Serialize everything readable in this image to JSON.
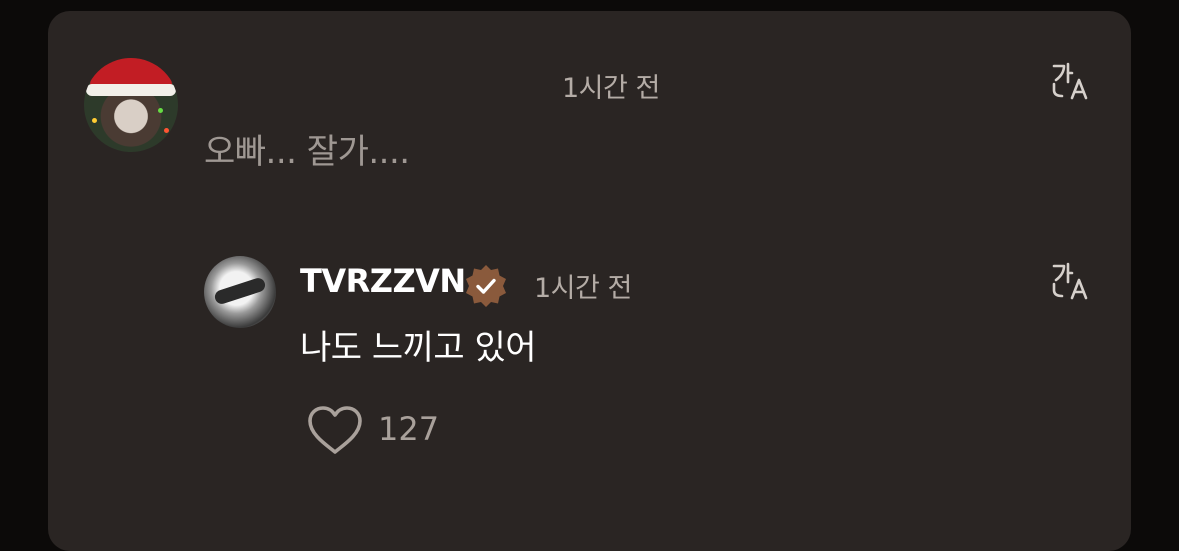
{
  "comment": {
    "time": "1시간 전",
    "text": "오빠... 잘가....",
    "translate_icon": "translate-icon"
  },
  "reply": {
    "username": "TVRZZVN",
    "verified_icon": "verified-badge-icon",
    "time": "1시간 전",
    "text": "나도 느끼고 있어",
    "translate_icon": "translate-icon",
    "like_icon": "heart-outline-icon",
    "like_count": "127"
  },
  "colors": {
    "background": "#0c0a09",
    "card": "#2a2523",
    "verified_badge": "#8a5a3c",
    "muted_text": "#b4aca6",
    "primary_text": "#ffffff"
  }
}
